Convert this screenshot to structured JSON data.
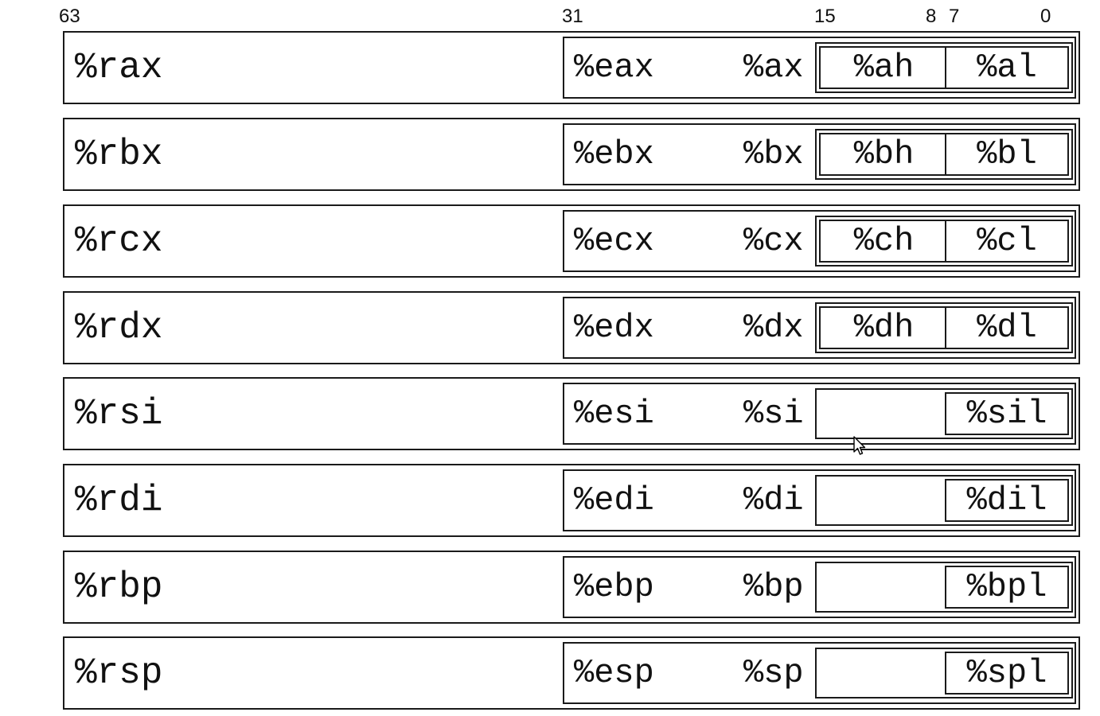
{
  "bit_labels": [
    "63",
    "31",
    "15",
    "8",
    "7",
    "0"
  ],
  "registers": [
    {
      "r64": "%rax",
      "r32": "%eax",
      "r16": "%ax",
      "high8": "%ah",
      "low8": "%al"
    },
    {
      "r64": "%rbx",
      "r32": "%ebx",
      "r16": "%bx",
      "high8": "%bh",
      "low8": "%bl"
    },
    {
      "r64": "%rcx",
      "r32": "%ecx",
      "r16": "%cx",
      "high8": "%ch",
      "low8": "%cl"
    },
    {
      "r64": "%rdx",
      "r32": "%edx",
      "r16": "%dx",
      "high8": "%dh",
      "low8": "%dl"
    },
    {
      "r64": "%rsi",
      "r32": "%esi",
      "r16": "%si",
      "high8": "",
      "low8": "%sil"
    },
    {
      "r64": "%rdi",
      "r32": "%edi",
      "r16": "%di",
      "high8": "",
      "low8": "%dil"
    },
    {
      "r64": "%rbp",
      "r32": "%ebp",
      "r16": "%bp",
      "high8": "",
      "low8": "%bpl"
    },
    {
      "r64": "%rsp",
      "r32": "%esp",
      "r16": "%sp",
      "high8": "",
      "low8": "%spl"
    }
  ],
  "icons": {
    "cursor": "mouse-pointer-icon"
  },
  "colors": {
    "line": "#1a1a1a",
    "text": "#111111",
    "background": "#ffffff"
  }
}
